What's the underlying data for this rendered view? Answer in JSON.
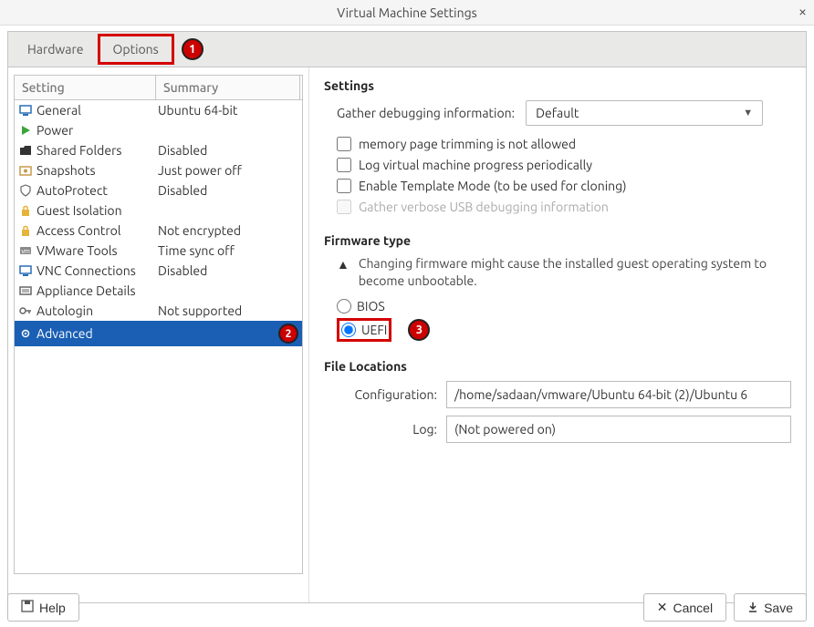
{
  "window": {
    "title": "Virtual Machine Settings",
    "close_label": "×"
  },
  "tabs": {
    "hardware": "Hardware",
    "options": "Options"
  },
  "callouts": {
    "one": "1",
    "two": "2",
    "three": "3"
  },
  "table": {
    "heading_setting": "Setting",
    "heading_summary": "Summary"
  },
  "rows": [
    {
      "icon": "general",
      "name": "General",
      "summary": "Ubuntu 64-bit"
    },
    {
      "icon": "power",
      "name": "Power",
      "summary": ""
    },
    {
      "icon": "folder",
      "name": "Shared Folders",
      "summary": "Disabled"
    },
    {
      "icon": "snapshot",
      "name": "Snapshots",
      "summary": "Just power off"
    },
    {
      "icon": "autoprotect",
      "name": "AutoProtect",
      "summary": "Disabled"
    },
    {
      "icon": "lock",
      "name": "Guest Isolation",
      "summary": ""
    },
    {
      "icon": "lock",
      "name": "Access Control",
      "summary": "Not encrypted"
    },
    {
      "icon": "tools",
      "name": "VMware Tools",
      "summary": "Time sync off"
    },
    {
      "icon": "vnc",
      "name": "VNC Connections",
      "summary": "Disabled"
    },
    {
      "icon": "appliance",
      "name": "Appliance Details",
      "summary": ""
    },
    {
      "icon": "key",
      "name": "Autologin",
      "summary": "Not supported"
    },
    {
      "icon": "advanced",
      "name": "Advanced",
      "summary": ""
    }
  ],
  "settings": {
    "title": "Settings",
    "debug_label": "Gather debugging information:",
    "debug_value": "Default",
    "cb_trim": "memory page trimming is not allowed",
    "cb_log": "Log virtual machine progress periodically",
    "cb_template": "Enable Template Mode (to be used for cloning)",
    "cb_usb": "Gather verbose USB debugging information"
  },
  "firmware": {
    "title": "Firmware type",
    "warning": "Changing firmware might cause the installed guest operating system to become unbootable.",
    "bios": "BIOS",
    "uefi": "UEFI"
  },
  "filelocations": {
    "title": "File Locations",
    "config_label": "Configuration:",
    "config_value": "/home/sadaan/vmware/Ubuntu 64-bit (2)/Ubuntu 6",
    "log_label": "Log:",
    "log_value": "(Not powered on)"
  },
  "buttons": {
    "help": "Help",
    "cancel": "Cancel",
    "save": "Save"
  }
}
